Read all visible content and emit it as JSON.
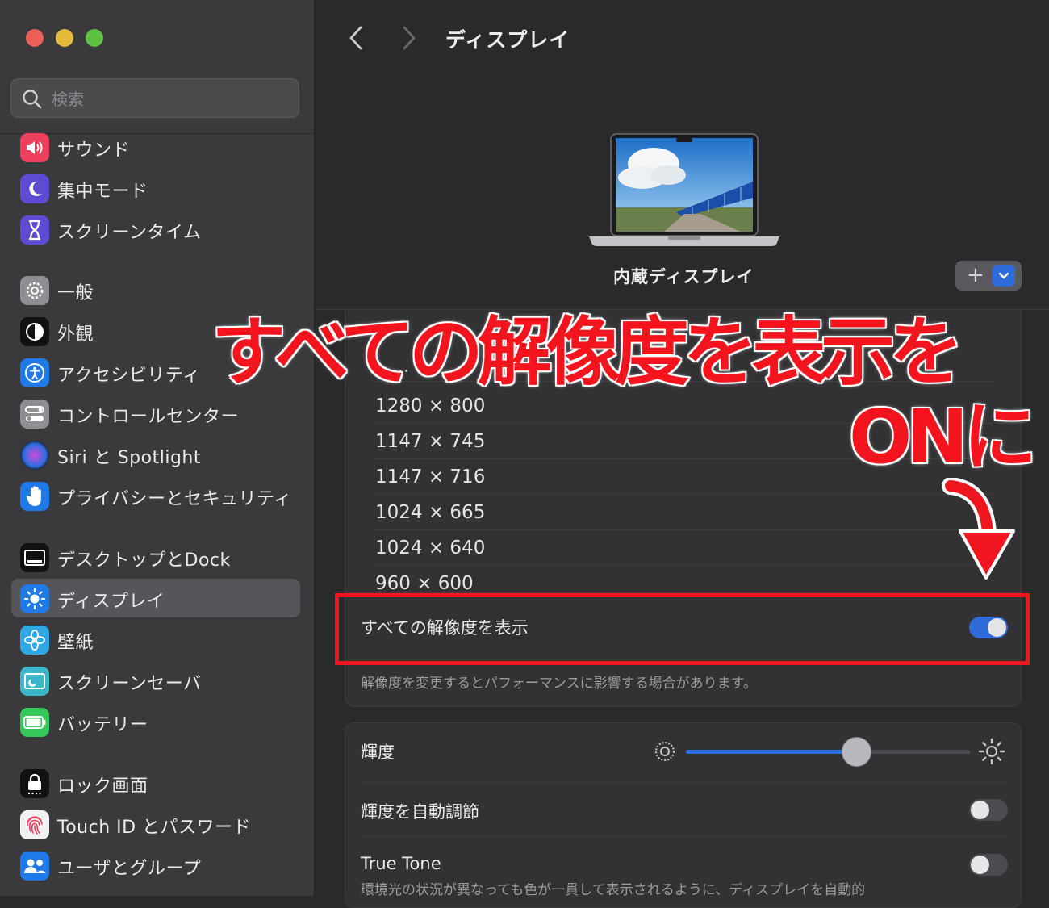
{
  "window": {
    "title": "ディスプレイ"
  },
  "colors": {
    "accent": "#2f6bd8",
    "annotation": "#ef1620"
  },
  "sidebar": {
    "search": {
      "placeholder": "検索"
    },
    "items": [
      {
        "label": "サウンド",
        "icon": "speaker-icon"
      },
      {
        "label": "集中モード",
        "icon": "moon-icon"
      },
      {
        "label": "スクリーンタイム",
        "icon": "hourglass-icon"
      },
      {
        "label": "一般",
        "icon": "gear-icon"
      },
      {
        "label": "外観",
        "icon": "appearance-icon"
      },
      {
        "label": "アクセシビリティ",
        "icon": "accessibility-icon"
      },
      {
        "label": "コントロールセンター",
        "icon": "control-center-icon"
      },
      {
        "label": "Siri と Spotlight",
        "icon": "siri-icon"
      },
      {
        "label": "プライバシーとセキュリティ",
        "icon": "hand-icon"
      },
      {
        "label": "デスクトップとDock",
        "icon": "dock-icon"
      },
      {
        "label": "ディスプレイ",
        "icon": "sun-icon",
        "selected": true
      },
      {
        "label": "壁紙",
        "icon": "flower-icon"
      },
      {
        "label": "スクリーンセーバ",
        "icon": "screensaver-icon"
      },
      {
        "label": "バッテリー",
        "icon": "battery-icon"
      },
      {
        "label": "ロック画面",
        "icon": "lock-icon"
      },
      {
        "label": "Touch ID とパスワード",
        "icon": "fingerprint-icon"
      },
      {
        "label": "ユーザとグループ",
        "icon": "users-icon"
      }
    ]
  },
  "main": {
    "title": "ディスプレイ",
    "display_name": "内蔵ディスプレイ",
    "add_button": "+",
    "resolutions": [
      "1280 × 800",
      "1147 × 745",
      "1147 × 716",
      "1024 × 665",
      "1024 × 640",
      "960 × 600"
    ],
    "show_all": {
      "label": "すべての解像度を表示",
      "on": true
    },
    "note": "解像度を変更するとパフォーマンスに影響する場合があります。",
    "brightness": {
      "label": "輝度",
      "value": 0.6
    },
    "auto_brightness": {
      "label": "輝度を自動調節",
      "on": false
    },
    "true_tone": {
      "label": "True Tone",
      "on": false,
      "description": "環境光の状況が異なっても色が一貫して表示されるように、ディスプレイを自動的"
    }
  },
  "annotation": {
    "line1": "すべての解像度を表示を",
    "line2": "ONに"
  }
}
